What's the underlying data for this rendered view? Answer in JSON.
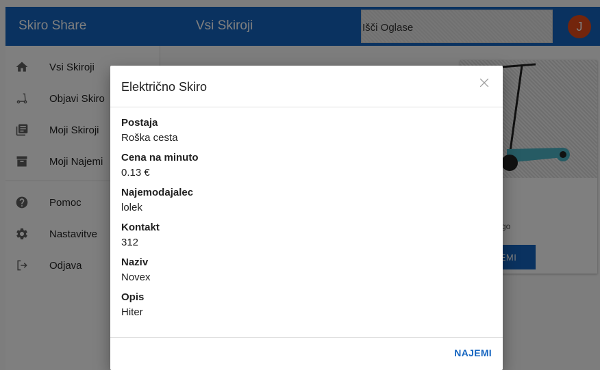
{
  "appbar": {
    "brand": "Skiro Share",
    "title": "Vsi Skiroji",
    "search_placeholder": "Išči Oglase",
    "avatar_initial": "J",
    "color": "#1565c0",
    "avatar_color": "#e64a19"
  },
  "drawer": {
    "items": [
      {
        "label": "Vsi Skiroji",
        "icon": "home-icon"
      },
      {
        "label": "Objavi Skiro",
        "icon": "scooter-icon"
      },
      {
        "label": "Moji Skiroji",
        "icon": "library-icon"
      },
      {
        "label": "Moji Najemi",
        "icon": "archive-icon"
      },
      {
        "label": "Pomoc",
        "icon": "help-icon"
      },
      {
        "label": "Nastavitve",
        "icon": "gear-icon"
      },
      {
        "label": "Odjava",
        "icon": "logout-icon"
      }
    ]
  },
  "background_card": {
    "desc_fragment": "go",
    "button_fragment": "EMI"
  },
  "dialog": {
    "title": "Električno Skiro",
    "fields": [
      {
        "label": "Postaja",
        "value": "Roška cesta"
      },
      {
        "label": "Cena na minuto",
        "value": "0.13 €"
      },
      {
        "label": "Najemodajalec",
        "value": "lolek"
      },
      {
        "label": "Kontakt",
        "value": "312"
      },
      {
        "label": "Naziv",
        "value": "Novex"
      },
      {
        "label": "Opis",
        "value": "Hiter"
      }
    ],
    "action_label": "NAJEMI"
  }
}
